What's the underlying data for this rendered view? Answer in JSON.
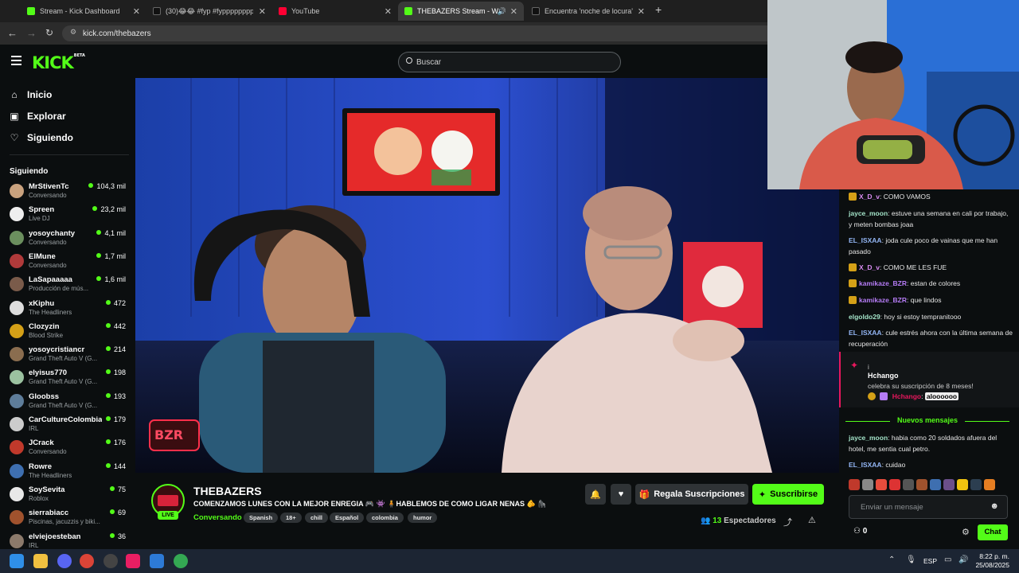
{
  "browser": {
    "tabs": [
      {
        "title": "Stream - Kick Dashboard",
        "color": "#53fc18"
      },
      {
        "title": "(30)😂😂 #fyp #fyppppppppp",
        "color": "#111111"
      },
      {
        "title": "YouTube",
        "color": "#ff0033"
      },
      {
        "title": "THEBAZERS Stream - Watch",
        "color": "#53fc18"
      },
      {
        "title": "Encuentra 'noche de locura' en",
        "color": "#111111"
      }
    ],
    "new_tab": "+",
    "url": "kick.com/thebazers"
  },
  "header": {
    "logo": "KICK",
    "logo_tag": "BETA",
    "search_placeholder": "Buscar"
  },
  "sidebar": {
    "nav": [
      {
        "label": "Inicio",
        "icon": "home-icon"
      },
      {
        "label": "Explorar",
        "icon": "compass-icon"
      },
      {
        "label": "Siguiendo",
        "icon": "heart-icon"
      }
    ],
    "following_title": "Siguiendo",
    "following": [
      {
        "name": "MrStivenTc",
        "category": "Conversando",
        "viewers": "104,3 mil",
        "color": "#c9a27e"
      },
      {
        "name": "Spreen",
        "category": "Live DJ",
        "viewers": "23,2 mil",
        "color": "#eeeeee"
      },
      {
        "name": "yosoychanty",
        "category": "Conversando",
        "viewers": "4,1 mil",
        "color": "#6b8f5e"
      },
      {
        "name": "ElMune",
        "category": "Conversando",
        "viewers": "1,7 mil",
        "color": "#b03a3a"
      },
      {
        "name": "LaSapaaaaa",
        "category": "Producción de mús...",
        "viewers": "1,6 mil",
        "color": "#7a5b4a"
      },
      {
        "name": "xKiphu",
        "category": "The Headliners",
        "viewers": "472",
        "color": "#dddddd"
      },
      {
        "name": "Clozyzin",
        "category": "Blood Strike",
        "viewers": "442",
        "color": "#d4a017"
      },
      {
        "name": "yosoycristiancr",
        "category": "Grand Theft Auto V (G...",
        "viewers": "214",
        "color": "#8a6d4f"
      },
      {
        "name": "elyisus770",
        "category": "Grand Theft Auto V (G...",
        "viewers": "198",
        "color": "#9bc2a0"
      },
      {
        "name": "Gloobss",
        "category": "Grand Theft Auto V (G...",
        "viewers": "193",
        "color": "#5e7d9a"
      },
      {
        "name": "CarCultureColombia",
        "category": "IRL",
        "viewers": "179",
        "color": "#cccccc"
      },
      {
        "name": "JCrack",
        "category": "Conversando",
        "viewers": "176",
        "color": "#c0392b"
      },
      {
        "name": "Rowre",
        "category": "The Headliners",
        "viewers": "144",
        "color": "#3e6fb0"
      },
      {
        "name": "SoySevita",
        "category": "Roblox",
        "viewers": "75",
        "color": "#e8e8e8"
      },
      {
        "name": "sierrabiacc",
        "category": "Piscinas, jacuzzis y biki...",
        "viewers": "69",
        "color": "#a0522d"
      },
      {
        "name": "elviejoesteban",
        "category": "IRL",
        "viewers": "36",
        "color": "#8c7a6b"
      }
    ]
  },
  "video": {
    "overlay_logo": "BZR"
  },
  "stream": {
    "channel": "THEBAZERS",
    "live": "LIVE",
    "title": "COMENZAMOS LUNES CON LA MEJOR ENREGIA 🎮 👾 🧍HABLEMOS DE COMO LIGAR NENAS 🫵 🦍",
    "category": "Conversando",
    "tags": [
      "Spanish",
      "18+",
      "chill",
      "Español",
      "colombia",
      "humor"
    ],
    "gift_label": "Regala Suscripciones",
    "subscribe_label": "Suscribirse",
    "viewers_count": "13",
    "viewers_label": "Espectadores"
  },
  "chat": {
    "messages": [
      {
        "user": "X_D_v",
        "text": "COMO VAMOS",
        "color": "#d98cf2",
        "badge": "#d4a017"
      },
      {
        "user": "jayce_moon",
        "text": "estuve una semana en cali por trabajo, y meten bombas joaa",
        "color": "#a3e3c8"
      },
      {
        "user": "EL_ISXAA",
        "text": "joda cule poco de vainas que me han pasado",
        "color": "#93b6f5"
      },
      {
        "user": "X_D_v",
        "text": "COMO ME LES FUE",
        "color": "#d98cf2",
        "badge": "#d4a017"
      },
      {
        "user": "kamikaze_BZR",
        "text": "estan de colores",
        "color": "#b57cf5",
        "badge": "#d4a017"
      },
      {
        "user": "kamikaze_BZR",
        "text": "que lindos",
        "color": "#b57cf5",
        "badge": "#d4a017"
      },
      {
        "user": "elgoldo29",
        "text": "hoy si estoy tempranitooo",
        "color": "#a3e3c8"
      },
      {
        "user": "EL_ISXAA",
        "text": "cule estrés ahora con la última semana de recuperación",
        "color": "#93b6f5"
      }
    ],
    "sub_notice": {
      "prefix": "i",
      "user": "Hchango",
      "text": "celebra su suscripción de 8 meses!",
      "chat_user": "Hchango",
      "chat_text": "aloooooo"
    },
    "new_messages_label": "Nuevos mensajes",
    "new_messages": [
      {
        "user": "jayce_moon",
        "text": "habia como 20 soldados afuera del hotel, me sentia cual petro.",
        "color": "#a3e3c8"
      },
      {
        "user": "EL_ISXAA",
        "text": "cuidao",
        "color": "#93b6f5"
      }
    ],
    "input_placeholder": "Enviar un mensaje",
    "points": "0",
    "send_label": "Chat"
  },
  "taskbar": {
    "language": "ESP",
    "time": "8:22 p. m.",
    "date": "25/08/2025"
  }
}
